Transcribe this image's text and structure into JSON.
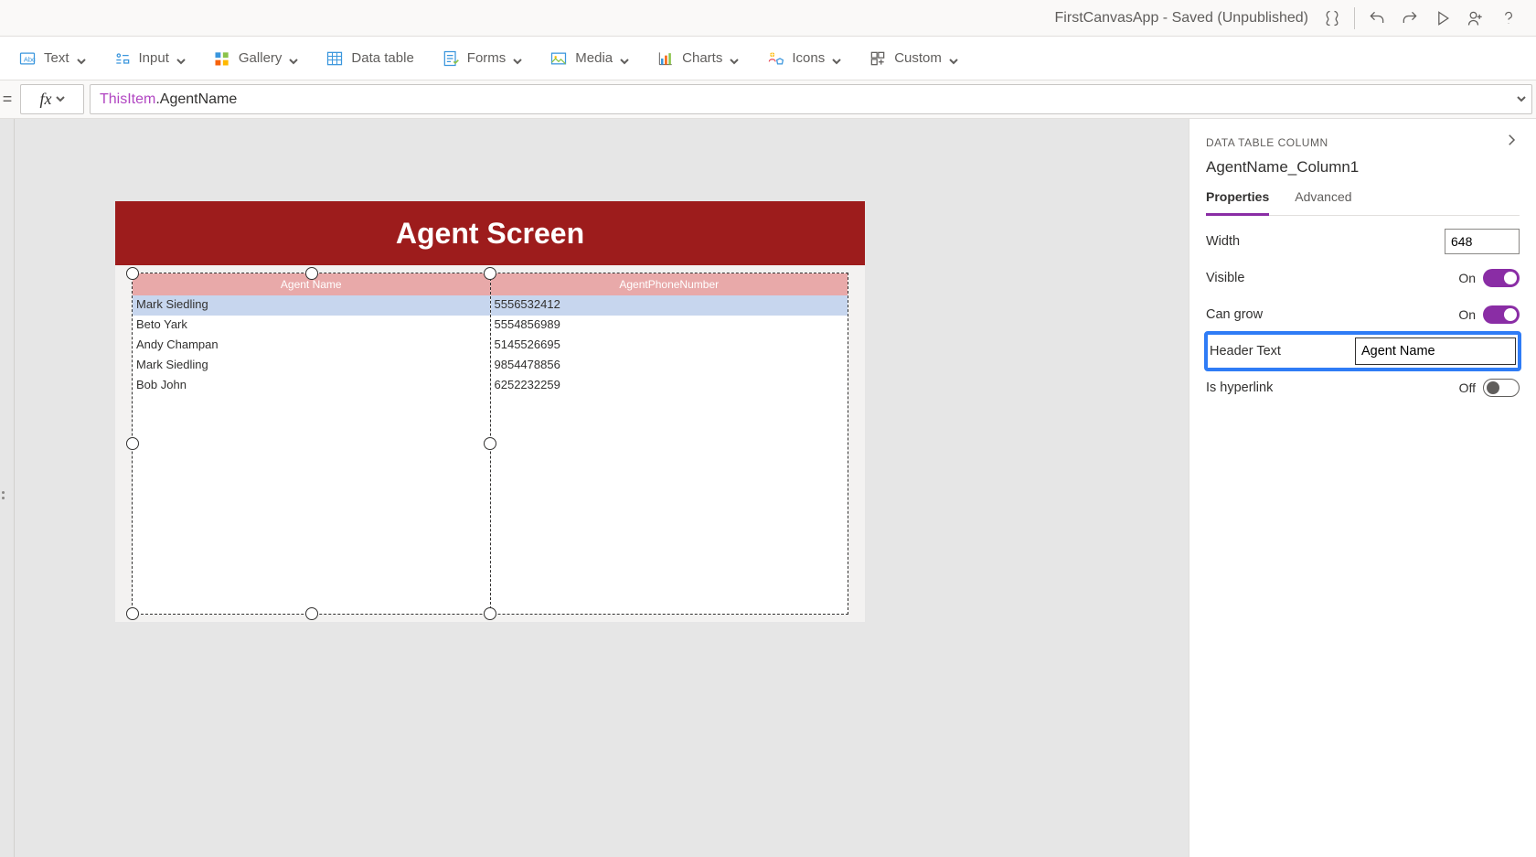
{
  "titlebar": {
    "app_title": "FirstCanvasApp - Saved (Unpublished)"
  },
  "ribbon": {
    "text": "Text",
    "input": "Input",
    "gallery": "Gallery",
    "data_table": "Data table",
    "forms": "Forms",
    "media": "Media",
    "charts": "Charts",
    "icons": "Icons",
    "custom": "Custom"
  },
  "formula": {
    "equals": "=",
    "fx": "fx",
    "token_this": "ThisItem",
    "token_rest": ".AgentName"
  },
  "screen": {
    "header": "Agent Screen",
    "columns": [
      "Agent Name",
      "AgentPhoneNumber"
    ],
    "rows": [
      {
        "name": "Mark Siedling",
        "phone": "5556532412"
      },
      {
        "name": "Beto Yark",
        "phone": "5554856989"
      },
      {
        "name": "Andy Champan",
        "phone": "5145526695"
      },
      {
        "name": "Mark Siedling",
        "phone": "9854478856"
      },
      {
        "name": "Bob John",
        "phone": "6252232259"
      }
    ]
  },
  "panel": {
    "title": "DATA TABLE COLUMN",
    "subtitle": "AgentName_Column1",
    "tabs": {
      "properties": "Properties",
      "advanced": "Advanced"
    },
    "props": {
      "width_label": "Width",
      "width_value": "648",
      "visible_label": "Visible",
      "visible_value": "On",
      "cangrow_label": "Can grow",
      "cangrow_value": "On",
      "headertext_label": "Header Text",
      "headertext_value": "Agent Name",
      "hyperlink_label": "Is hyperlink",
      "hyperlink_value": "Off"
    }
  }
}
